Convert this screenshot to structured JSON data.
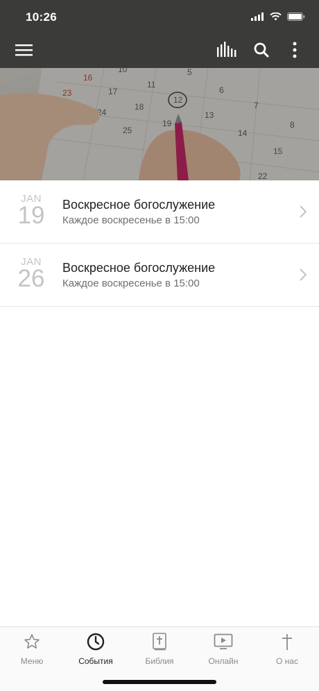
{
  "status_bar": {
    "time": "10:26",
    "icons": [
      "signal-icon",
      "wifi-icon",
      "battery-icon"
    ]
  },
  "app_bar": {
    "icons": [
      "menu-icon",
      "chart-bars-icon",
      "search-icon",
      "more-vertical-icon"
    ]
  },
  "hero": {
    "image": "calendar-hand-pen-photo"
  },
  "events": [
    {
      "month": "JAN",
      "day": "19",
      "title": "Воскресное богослужение",
      "subtitle": "Каждое воскресенье в 15:00"
    },
    {
      "month": "JAN",
      "day": "26",
      "title": "Воскресное богослужение",
      "subtitle": "Каждое воскресенье в 15:00"
    }
  ],
  "tabs": [
    {
      "label": "Меню",
      "icon": "star-icon",
      "active": false
    },
    {
      "label": "События",
      "icon": "clock-icon",
      "active": true
    },
    {
      "label": "Библия",
      "icon": "bible-icon",
      "active": false
    },
    {
      "label": "Онлайн",
      "icon": "tv-play-icon",
      "active": false
    },
    {
      "label": "О нас",
      "icon": "cross-icon",
      "active": false
    }
  ],
  "colors": {
    "header_bg": "#3b3b39",
    "active_tab": "#222222",
    "inactive_tab": "#8a8a8a",
    "date_text": "#c4c4c4",
    "pen_accent": "#c2185b"
  }
}
